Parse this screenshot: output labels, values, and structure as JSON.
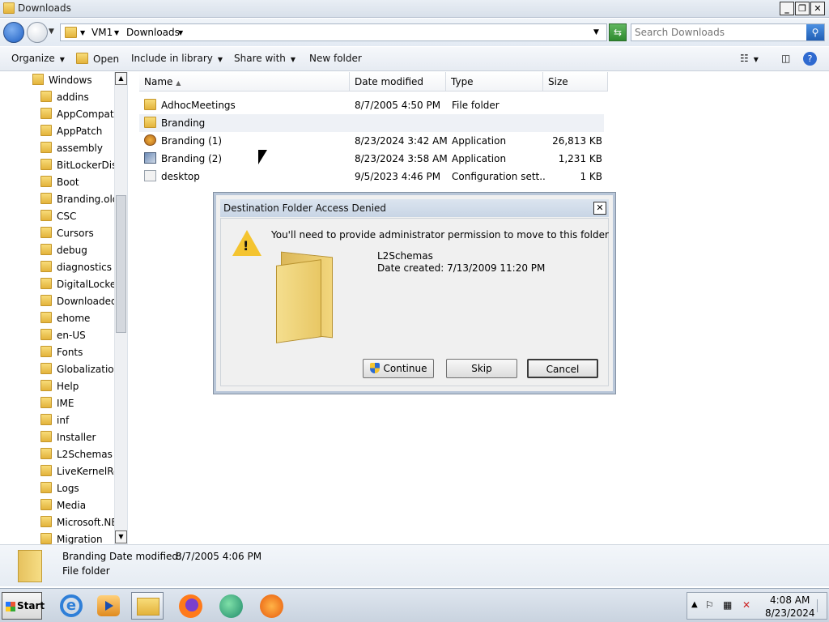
{
  "window": {
    "title": "Downloads"
  },
  "address": {
    "crumbs": [
      "VM1",
      "Downloads"
    ],
    "search_placeholder": "Search Downloads"
  },
  "toolbar": {
    "organize": "Organize",
    "open": "Open",
    "include": "Include in library",
    "share": "Share with",
    "newfolder": "New folder"
  },
  "nav": {
    "root": "Windows",
    "items": [
      "addins",
      "AppCompat",
      "AppPatch",
      "assembly",
      "BitLockerDisc",
      "Boot",
      "Branding.old",
      "CSC",
      "Cursors",
      "debug",
      "diagnostics",
      "DigitalLocker",
      "Downloaded",
      "ehome",
      "en-US",
      "Fonts",
      "Globalization",
      "Help",
      "IME",
      "inf",
      "Installer",
      "L2Schemas",
      "LiveKernelRep",
      "Logs",
      "Media",
      "Microsoft.NE",
      "Migration"
    ]
  },
  "columns": {
    "name": "Name",
    "date": "Date modified",
    "type": "Type",
    "size": "Size"
  },
  "files": [
    {
      "name": "AdhocMeetings",
      "date": "8/7/2005 4:50 PM",
      "type": "File folder",
      "size": ""
    },
    {
      "name": "Branding",
      "date": "",
      "type": "",
      "size": ""
    },
    {
      "name": "Branding (1)",
      "date": "8/23/2024 3:42 AM",
      "type": "Application",
      "size": "26,813 KB"
    },
    {
      "name": "Branding (2)",
      "date": "8/23/2024 3:58 AM",
      "type": "Application",
      "size": "1,231 KB"
    },
    {
      "name": "desktop",
      "date": "9/5/2023 4:46 PM",
      "type": "Configuration sett...",
      "size": "1 KB"
    }
  ],
  "details": {
    "name": "Branding",
    "date_label": "Date modified:",
    "date": "8/7/2005 4:06 PM",
    "kind": "File folder"
  },
  "dialog": {
    "title": "Destination Folder Access Denied",
    "message": "You'll need to provide administrator permission to move to this folder",
    "folder_name": "L2Schemas",
    "folder_date": "Date created: 7/13/2009 11:20 PM",
    "continue": "Continue",
    "skip": "Skip",
    "cancel": "Cancel"
  },
  "taskbar": {
    "start": "Start",
    "time": "4:08 AM",
    "date": "8/23/2024"
  }
}
